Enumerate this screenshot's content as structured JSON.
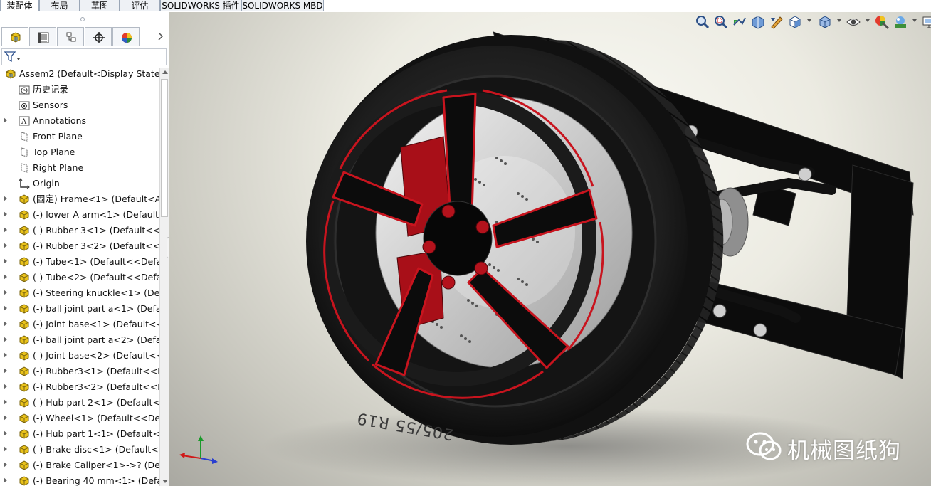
{
  "tabs": [
    {
      "label": "装配体",
      "active": true
    },
    {
      "label": "布局",
      "active": false
    },
    {
      "label": "草图",
      "active": false
    },
    {
      "label": "评估",
      "active": false
    },
    {
      "label": "SOLIDWORKS 插件",
      "active": false
    },
    {
      "label": "SOLIDWORKS MBD",
      "active": false
    }
  ],
  "feature_manager": {
    "tabs": [
      "feature-manager-tree",
      "property-manager",
      "configuration-manager",
      "dimxpert-manager",
      "display-manager"
    ],
    "tree": [
      {
        "label": "Assem2  (Default<Display State-1",
        "icon": "assembly-icon",
        "expandable": false,
        "level": 0
      },
      {
        "label": "历史记录",
        "icon": "history-folder-icon",
        "expandable": false,
        "level": 1
      },
      {
        "label": "Sensors",
        "icon": "sensors-folder-icon",
        "expandable": false,
        "level": 1
      },
      {
        "label": "Annotations",
        "icon": "annotations-icon",
        "expandable": true,
        "level": 1
      },
      {
        "label": "Front Plane",
        "icon": "plane-icon",
        "expandable": false,
        "level": 1
      },
      {
        "label": "Top Plane",
        "icon": "plane-icon",
        "expandable": false,
        "level": 1
      },
      {
        "label": "Right Plane",
        "icon": "plane-icon",
        "expandable": false,
        "level": 1
      },
      {
        "label": "Origin",
        "icon": "origin-icon",
        "expandable": false,
        "level": 1
      },
      {
        "label": "(固定) Frame<1> (Default<As",
        "icon": "part-icon",
        "expandable": true,
        "level": 1
      },
      {
        "label": "(-) lower A arm<1> (Default<",
        "icon": "part-icon",
        "expandable": true,
        "level": 1
      },
      {
        "label": "(-) Rubber 3<1> (Default<<D",
        "icon": "part-icon",
        "expandable": true,
        "level": 1
      },
      {
        "label": "(-) Rubber 3<2> (Default<<D",
        "icon": "part-icon",
        "expandable": true,
        "level": 1
      },
      {
        "label": "(-) Tube<1> (Default<<Defau",
        "icon": "part-icon",
        "expandable": true,
        "level": 1
      },
      {
        "label": "(-) Tube<2> (Default<<Defau",
        "icon": "part-icon",
        "expandable": true,
        "level": 1
      },
      {
        "label": "(-) Steering knuckle<1> (Defa",
        "icon": "part-icon",
        "expandable": true,
        "level": 1
      },
      {
        "label": "(-) ball joint part a<1> (Defau",
        "icon": "part-icon",
        "expandable": true,
        "level": 1
      },
      {
        "label": "(-) Joint base<1> (Default<<D",
        "icon": "part-icon",
        "expandable": true,
        "level": 1
      },
      {
        "label": "(-) ball joint part a<2> (Defau",
        "icon": "part-icon",
        "expandable": true,
        "level": 1
      },
      {
        "label": "(-) Joint base<2> (Default<<D",
        "icon": "part-icon",
        "expandable": true,
        "level": 1
      },
      {
        "label": "(-) Rubber3<1> (Default<<De",
        "icon": "part-icon",
        "expandable": true,
        "level": 1
      },
      {
        "label": "(-) Rubber3<2> (Default<<De",
        "icon": "part-icon",
        "expandable": true,
        "level": 1
      },
      {
        "label": "(-) Hub part 2<1> (Default<<",
        "icon": "part-icon",
        "expandable": true,
        "level": 1
      },
      {
        "label": "(-) Wheel<1> (Default<<Defa",
        "icon": "part-icon",
        "expandable": true,
        "level": 1
      },
      {
        "label": "(-) Hub part 1<1> (Default<<",
        "icon": "part-icon",
        "expandable": true,
        "level": 1
      },
      {
        "label": "(-) Brake disc<1> (Default<<I",
        "icon": "part-icon",
        "expandable": true,
        "level": 1
      },
      {
        "label": "(-) Brake Caliper<1>->? (Defa",
        "icon": "part-icon",
        "expandable": true,
        "level": 1
      },
      {
        "label": "(-) Bearing 40 mm<1> (Defau",
        "icon": "part-icon",
        "expandable": true,
        "level": 1
      }
    ]
  },
  "view_toolbar": [
    "zoom-to-fit-icon",
    "zoom-to-area-icon",
    "previous-view-icon",
    "section-view-icon",
    "dynamic-annotation-icon",
    "view-orientation-icon",
    "display-style-icon",
    "hide-show-icon",
    "edit-appearance-icon",
    "apply-scene-icon",
    "view-settings-icon"
  ],
  "model": {
    "tire_sidewall_text": "205/55 R19"
  },
  "watermark": {
    "text": "机械图纸狗",
    "icon": "wechat-icon"
  },
  "colors": {
    "rim_accent": "#c8141e",
    "caliper": "#a80f18",
    "tire": "#1b1b1b",
    "frame": "#0c0c0c"
  }
}
